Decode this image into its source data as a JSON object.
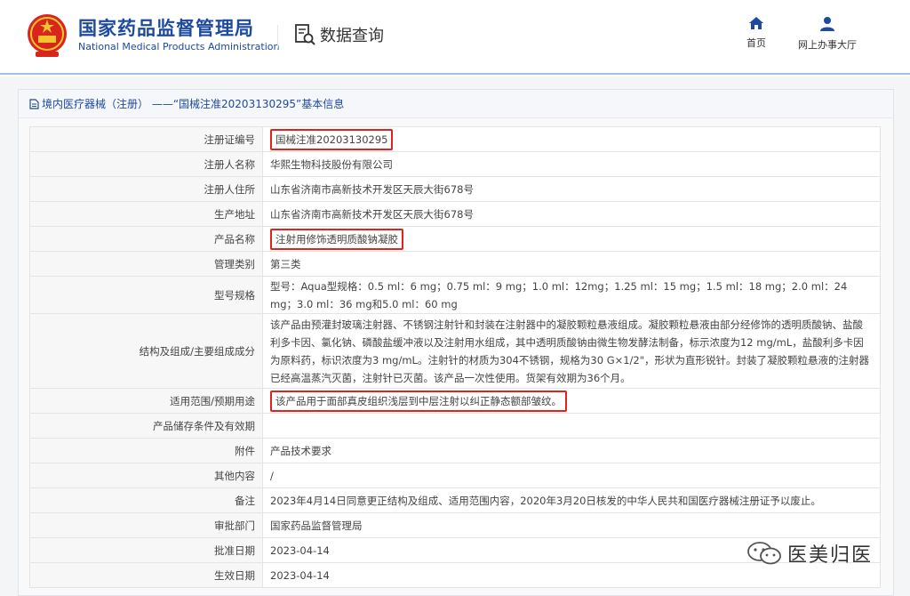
{
  "header": {
    "org_name_cn": "国家药品监督管理局",
    "org_name_en": "National Medical Products Administration",
    "data_query_label": "数据查询",
    "nav": [
      {
        "label": "首页",
        "icon": "home-icon"
      },
      {
        "label": "网上办事大厅",
        "icon": "user-icon"
      }
    ],
    "brand_color": "#1d4aa0"
  },
  "panel": {
    "title": "境内医疗器械（注册） ——“国械注准20203130295”基本信息"
  },
  "record": [
    {
      "key": "注册证编号",
      "value": "国械注准20203130295",
      "highlight": true
    },
    {
      "key": "注册人名称",
      "value": "华熙生物科技股份有限公司"
    },
    {
      "key": "注册人住所",
      "value": "山东省济南市高新技术开发区天辰大街678号"
    },
    {
      "key": "生产地址",
      "value": "山东省济南市高新技术开发区天辰大街678号"
    },
    {
      "key": "产品名称",
      "value": "注射用修饰透明质酸钠凝胶",
      "highlight": true
    },
    {
      "key": "管理类别",
      "value": "第三类"
    },
    {
      "key": "型号规格",
      "value": "型号：Aqua型规格：0.5 ml：6 mg；0.75 ml：9 mg；1.0 ml：12mg；1.25 ml：15 mg；1.5 ml：18 mg；2.0 ml：24 mg；3.0 ml：36 mg和5.0 ml：60 mg"
    },
    {
      "key": "结构及组成/主要组成成分",
      "value": "该产品由预灌封玻璃注射器、不锈钢注射针和封装在注射器中的凝胶颗粒悬液组成。凝胶颗粒悬液由部分经修饰的透明质酸钠、盐酸利多卡因、氯化钠、磷酸盐缓冲液以及注射用水组成，其中透明质酸钠由微生物发酵法制备，标示浓度为12 mg/mL，盐酸利多卡因为原料药，标识浓度为3 mg/mL。注射针的材质为304不锈钢，规格为30 G×1/2\"，形状为直形锐针。封装了凝胶颗粒悬液的注射器已经高温蒸汽灭菌，注射针已灭菌。该产品一次性使用。货架有效期为36个月。"
    },
    {
      "key": "适用范围/预期用途",
      "value": "该产品用于面部真皮组织浅层到中层注射以纠正静态额部皱纹。",
      "highlight": true
    },
    {
      "key": "产品储存条件及有效期",
      "value": ""
    },
    {
      "key": "附件",
      "value": "产品技术要求"
    },
    {
      "key": "其他内容",
      "value": "/"
    },
    {
      "key": "备注",
      "value": "2023年4月14日同意更正结构及组成、适用范围内容，2020年3月20日核发的中华人民共和国医疗器械注册证予以废止。"
    },
    {
      "key": "审批部门",
      "value": "国家药品监督管理局"
    },
    {
      "key": "批准日期",
      "value": "2023-04-14"
    },
    {
      "key": "生效日期",
      "value": "2023-04-14"
    }
  ],
  "watermark": {
    "text": "医美归医",
    "icon": "wechat-icon"
  },
  "highlight_color": "#e0231c"
}
